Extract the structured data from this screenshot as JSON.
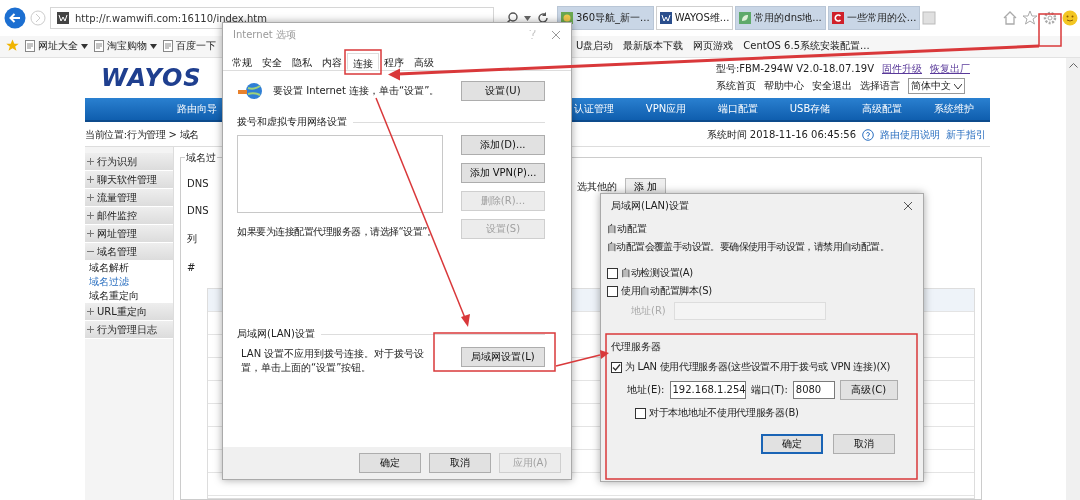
{
  "browser": {
    "address": "http://r.wamwifi.com:16110/index.htm",
    "tabs": [
      {
        "label": "360导航_新一...",
        "selected": false,
        "kind": "globe"
      },
      {
        "label": "WAYOS维...",
        "selected": true,
        "kind": "w"
      },
      {
        "label": "常用的dns地...",
        "selected": false,
        "kind": "leaf"
      },
      {
        "label": "一些常用的公...",
        "selected": false,
        "kind": "c"
      }
    ]
  },
  "favorites_left": [
    {
      "label": "网址大全",
      "dropdown": true
    },
    {
      "label": "淘宝购物",
      "dropdown": true
    },
    {
      "label": "百度一下",
      "dropdown": false
    }
  ],
  "favorites_right": [
    {
      "label": "U盘启动"
    },
    {
      "label": "最新版本下载"
    },
    {
      "label": "网页游戏"
    },
    {
      "label": "CentOS 6.5系统安装配置..."
    }
  ],
  "site": {
    "logo": "WAYOS",
    "model": "型号:FBM-294W V2.0-18.07.19V",
    "top_links": [
      "固件升级",
      "恢复出厂"
    ],
    "links": [
      "系统首页",
      "帮助中心",
      "安全退出",
      "选择语言"
    ],
    "language": "简体中文",
    "nav_left": [
      "路由向导"
    ],
    "nav_right": [
      "认证管理",
      "VPN应用",
      "端口配置",
      "USB存储",
      "高级配置",
      "系统维护"
    ],
    "breadcrumb": "当前位置:行为管理 > 域名",
    "time": "系统时间 2018-11-16 06:45:56",
    "help_links": [
      "路由使用说明",
      "新手指引"
    ],
    "sidebar": [
      {
        "label": "行为识别",
        "expanded": false
      },
      {
        "label": "聊天软件管理",
        "expanded": false
      },
      {
        "label": "流量管理",
        "expanded": false
      },
      {
        "label": "邮件监控",
        "expanded": false
      },
      {
        "label": "网址管理",
        "expanded": false
      },
      {
        "label": "域名管理",
        "expanded": true,
        "children": [
          {
            "label": "域名解析",
            "selected": false
          },
          {
            "label": "域名过滤",
            "selected": true
          },
          {
            "label": "域名重定向",
            "selected": false
          }
        ]
      },
      {
        "label": "URL重定向",
        "expanded": false
      },
      {
        "label": "行为管理日志",
        "expanded": false
      }
    ],
    "main": {
      "legend": "域名过",
      "labels": [
        "DNS",
        "DNS"
      ],
      "list_legend": "列",
      "column_1": "#",
      "note": "选其他的",
      "add_button": "添 加"
    }
  },
  "internet_options": {
    "title": "Internet 选项",
    "tabs": [
      {
        "label": "常规",
        "selected": false
      },
      {
        "label": "安全",
        "selected": false
      },
      {
        "label": "隐私",
        "selected": false
      },
      {
        "label": "内容",
        "selected": false
      },
      {
        "label": "连接",
        "selected": true
      },
      {
        "label": "程序",
        "selected": false
      },
      {
        "label": "高级",
        "selected": false
      }
    ],
    "setup_text": "要设置 Internet 连接，单击“设置”。",
    "setup_button": "设置(U)",
    "dialup_heading": "拨号和虚拟专用网络设置",
    "dialup_buttons": [
      {
        "label": "添加(D)...",
        "disabled": false
      },
      {
        "label": "添加 VPN(P)...",
        "disabled": false
      },
      {
        "label": "删除(R)...",
        "disabled": true
      },
      {
        "label": "设置(S)",
        "disabled": true
      }
    ],
    "proxy_hint": "如果要为连接配置代理服务器，请选择“设置”。",
    "lan_heading": "局域网(LAN)设置",
    "lan_text": "LAN 设置不应用到拨号连接。对于拨号设置，单击上面的“设置”按钮。",
    "lan_button": "局域网设置(L)",
    "footer_buttons": [
      {
        "label": "确定",
        "disabled": false
      },
      {
        "label": "取消",
        "disabled": false
      },
      {
        "label": "应用(A)",
        "disabled": true
      }
    ]
  },
  "lan_dialog": {
    "title": "局域网(LAN)设置",
    "auto_heading": "自动配置",
    "auto_text": "自动配置会覆盖手动设置。要确保使用手动设置，请禁用自动配置。",
    "auto_options": [
      {
        "label": "自动检测设置(A)",
        "checked": false
      },
      {
        "label": "使用自动配置脚本(S)",
        "checked": false
      }
    ],
    "script_label": "地址(R)",
    "proxy_heading": "代理服务器",
    "proxy_option": {
      "label": "为 LAN 使用代理服务器(这些设置不用于拨号或 VPN 连接)(X)",
      "checked": true
    },
    "address_label": "地址(E):",
    "address": "192.168.1.254",
    "port_label": "端口(T):",
    "port": "8080",
    "advanced_button": "高级(C)",
    "bypass_option": {
      "label": "对于本地地址不使用代理服务器(B)",
      "checked": false
    },
    "buttons": [
      "确定",
      "取消"
    ]
  }
}
